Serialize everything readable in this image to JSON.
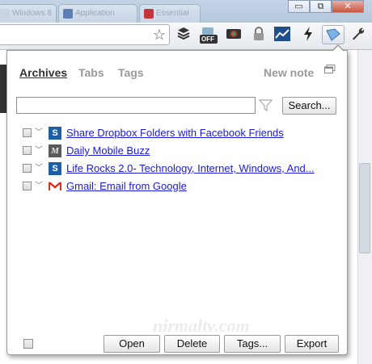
{
  "browser": {
    "tabs": [
      {
        "label": "Windows 8"
      },
      {
        "label": "Application"
      },
      {
        "label": "Essential"
      }
    ],
    "window_controls": {
      "minimize": "▭",
      "maximize": "⧉",
      "close": "✕"
    },
    "extensions": {
      "off_badge": "OFF"
    }
  },
  "popup": {
    "tabs": {
      "archives": "Archives",
      "tabs": "Tabs",
      "tags": "Tags"
    },
    "new_note": "New note",
    "search": {
      "value": "",
      "button_label": "Search..."
    },
    "bookmarks": [
      {
        "title": "Share Dropbox Folders with Facebook Friends",
        "icon": "site-s-icon"
      },
      {
        "title": "Daily Mobile Buzz",
        "icon": "site-m-icon"
      },
      {
        "title": "Life Rocks 2.0- Technology, Internet, Windows, And...",
        "icon": "site-s-icon"
      },
      {
        "title": "Gmail: Email from Google",
        "icon": "gmail-icon"
      }
    ],
    "footer": {
      "open": "Open",
      "delete": "Delete",
      "tags": "Tags...",
      "export": "Export"
    }
  },
  "watermark": "nirmaltv.com",
  "colors": {
    "link": "#1a1adb",
    "active_tab": "#333333",
    "inactive_tab": "#999999"
  }
}
